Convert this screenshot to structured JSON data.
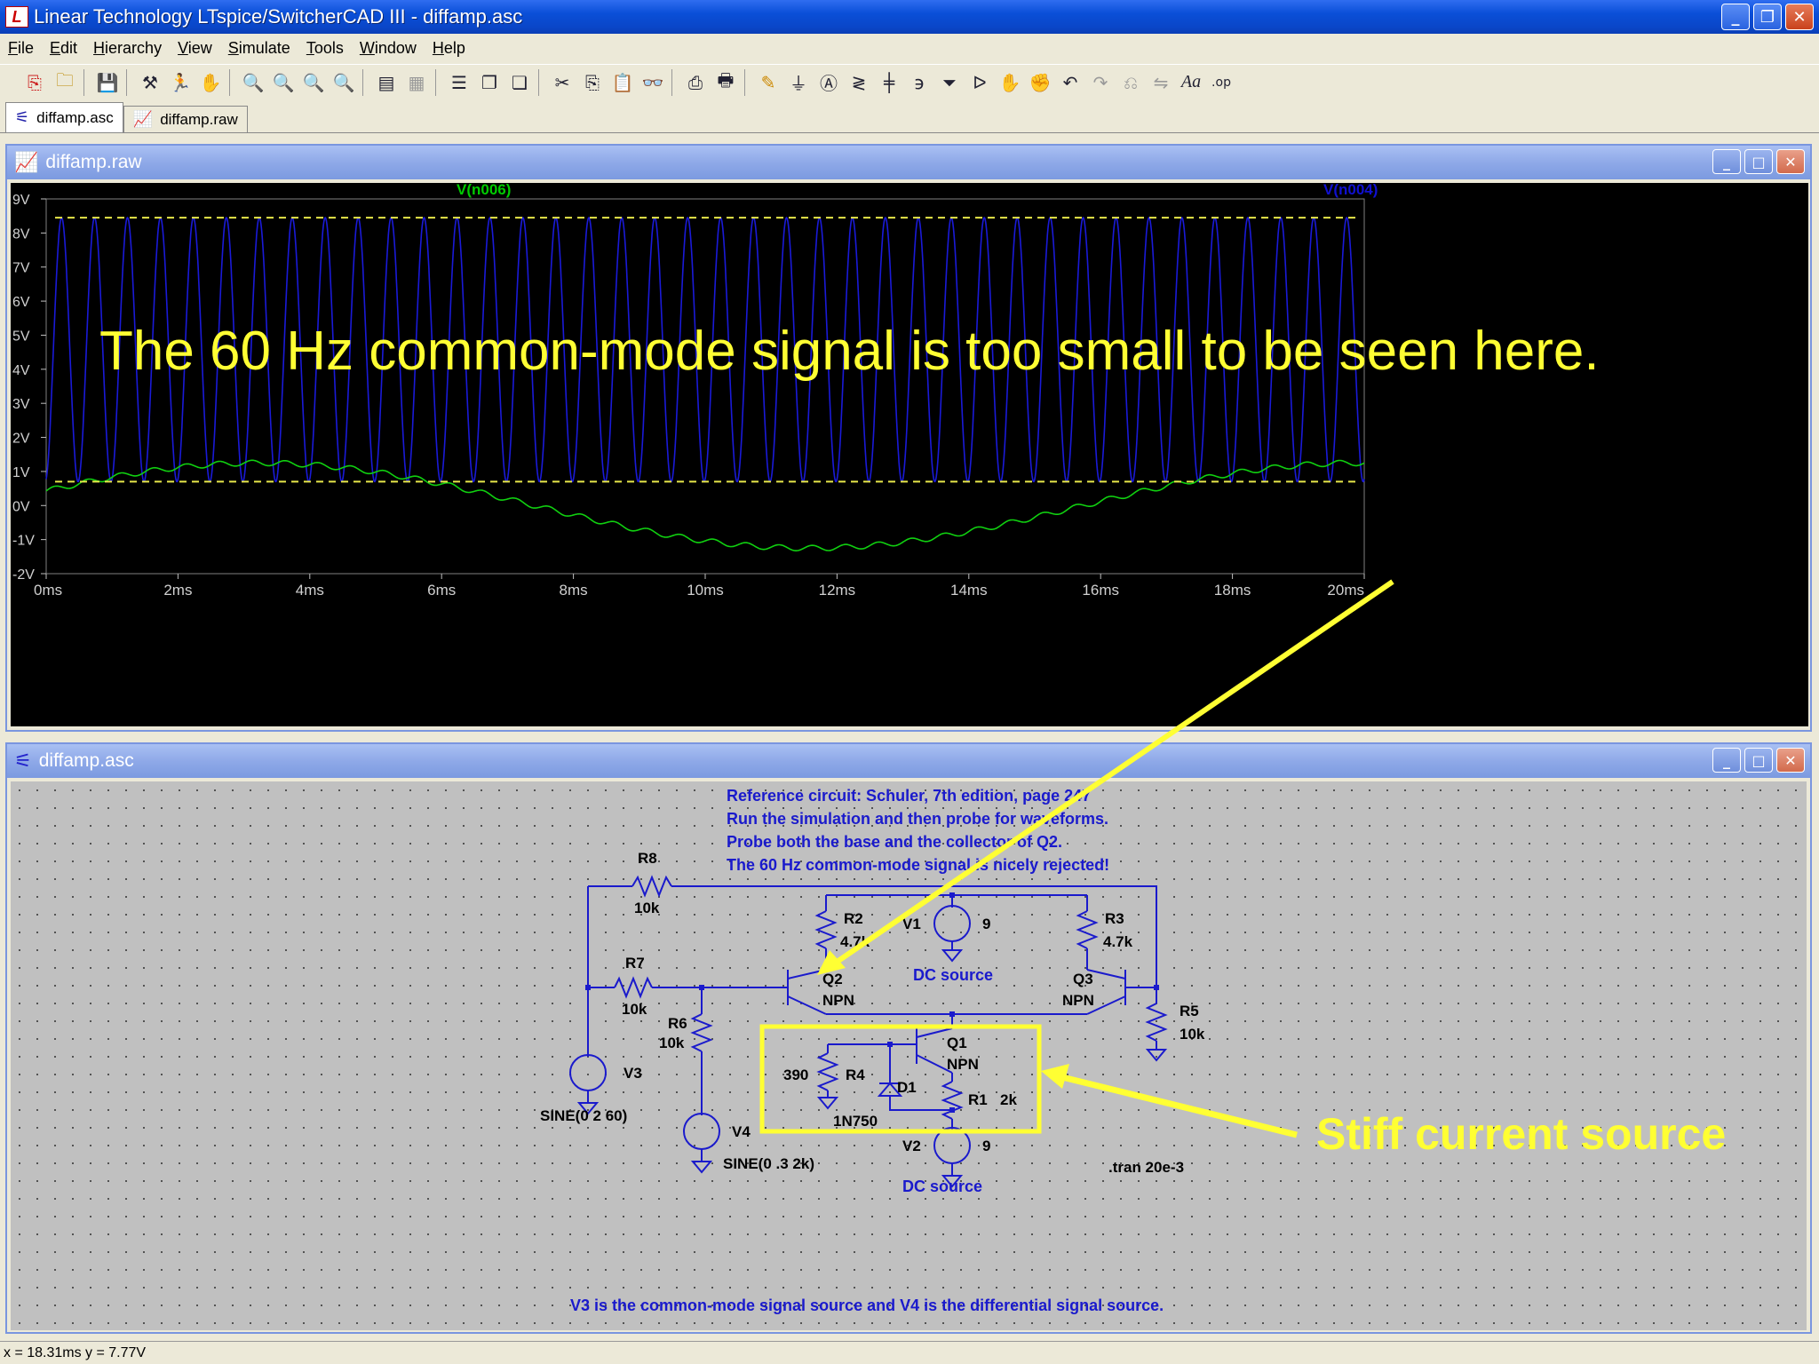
{
  "window": {
    "title": "Linear Technology LTspice/SwitcherCAD III - diffamp.asc",
    "buttons": {
      "minimize": "_",
      "maximize": "❐",
      "close": "✕"
    }
  },
  "menu": [
    "File",
    "Edit",
    "Hierarchy",
    "View",
    "Simulate",
    "Tools",
    "Window",
    "Help"
  ],
  "toolbar_icons": [
    "new-schematic-icon",
    "open-icon",
    "save-icon",
    "control-panel-icon",
    "run-icon",
    "halt-icon",
    "zoom-in-icon",
    "zoom-area-icon",
    "zoom-out-icon",
    "zoom-fit-icon",
    "autorange-icon",
    "grid-icon",
    "tile-horizontal-icon",
    "cascade-icon",
    "tile-vertical-icon",
    "cut-icon",
    "copy-icon",
    "paste-icon",
    "find-icon",
    "print-preview-icon",
    "print-icon",
    "wire-icon",
    "ground-icon",
    "label-net-icon",
    "resistor-icon",
    "capacitor-icon",
    "inductor-icon",
    "diode-icon",
    "component-icon",
    "move-icon",
    "drag-icon",
    "undo-icon",
    "redo-icon",
    "rotate-icon",
    "mirror-icon",
    "text-icon",
    "spice-directive-icon"
  ],
  "tabs": [
    {
      "label": "diffamp.asc",
      "active": true
    },
    {
      "label": "diffamp.raw",
      "active": false
    }
  ],
  "waveform_window": {
    "title": "diffamp.raw",
    "trace_labels": [
      {
        "name": "V(n006)",
        "color": "#00cc00"
      },
      {
        "name": "V(n004)",
        "color": "#1010d0"
      }
    ],
    "annotation": "The 60 Hz common-mode signal is too small to be seen here.",
    "annotation_color": "#ffff33"
  },
  "chart_data": {
    "type": "line",
    "x_tick_labels": [
      "0ms",
      "2ms",
      "4ms",
      "6ms",
      "8ms",
      "10ms",
      "12ms",
      "14ms",
      "16ms",
      "18ms",
      "20ms"
    ],
    "y_tick_labels": [
      "9V",
      "8V",
      "7V",
      "6V",
      "5V",
      "4V",
      "3V",
      "2V",
      "1V",
      "0V",
      "-1V",
      "-2V"
    ],
    "xlim": [
      0,
      20
    ],
    "ylim": [
      -2,
      9
    ],
    "x_unit": "ms",
    "y_unit": "V",
    "grid": false,
    "background": "#000000",
    "reference_lines": [
      8.45,
      0.7
    ],
    "series": [
      {
        "name": "V(n004)",
        "color": "#1a1ad8",
        "kind": "sine",
        "offset": 4.575,
        "amplitude": 3.875,
        "frequency_khz": 2,
        "clipped_to_20ms": true
      },
      {
        "name": "V(n006)",
        "color": "#10d010",
        "kind": "sine_plus_sine",
        "offset": 0.0,
        "amplitude": 1.25,
        "frequency_hz": 60,
        "ripple_amplitude": 0.08,
        "ripple_frequency_khz": 2
      }
    ]
  },
  "schematic_window": {
    "title": "diffamp.asc",
    "comments": [
      "Reference circuit:  Schuler, 7th edition, page 247",
      "Run the simulation and then probe for waveforms.",
      "Probe both the base and the collector of Q2.",
      "The 60 Hz common-mode signal is nicely rejected!"
    ],
    "footer_note": "V3 is the common-mode signal source and V4 is the differential signal source.",
    "directive": ".tran 20e-3",
    "components": {
      "r8": {
        "name": "R8",
        "value": "10k"
      },
      "r2": {
        "name": "R2",
        "value": "4.7k"
      },
      "r3": {
        "name": "R3",
        "value": "4.7k"
      },
      "r7": {
        "name": "R7",
        "value": "10k"
      },
      "r6": {
        "name": "R6",
        "value": "10k"
      },
      "r5": {
        "name": "R5",
        "value": "10k"
      },
      "r4": {
        "name": "R4",
        "value": "390"
      },
      "r1": {
        "name": "R1",
        "value": "2k"
      },
      "v1": {
        "name": "V1",
        "value": "9",
        "note": "DC source"
      },
      "v2": {
        "name": "V2",
        "value": "9",
        "note": "DC source"
      },
      "v3": {
        "name": "V3",
        "value": "SINE(0 2 60)"
      },
      "v4": {
        "name": "V4",
        "value": "SINE(0 .3 2k)"
      },
      "q1": {
        "name": "Q1",
        "value": "NPN"
      },
      "q2": {
        "name": "Q2",
        "value": "NPN"
      },
      "q3": {
        "name": "Q3",
        "value": "NPN"
      },
      "d1": {
        "name": "D1",
        "value": "1N750"
      }
    },
    "callout": "Stiff current source",
    "callout_color": "#ffff33"
  },
  "status": "x = 18.31ms    y = 7.77V"
}
